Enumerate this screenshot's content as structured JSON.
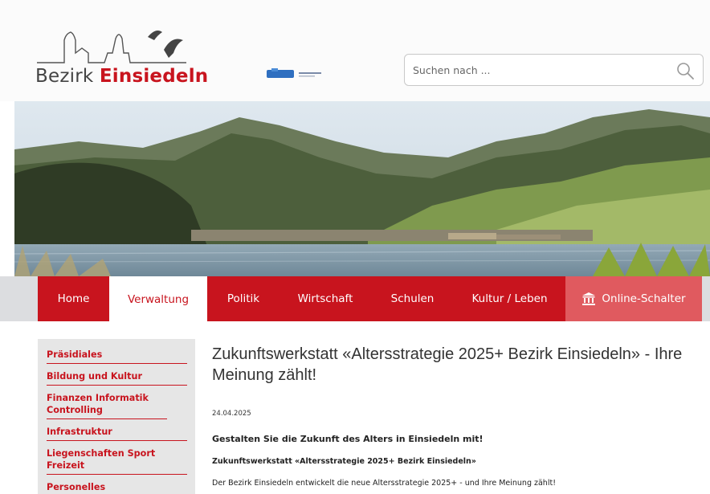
{
  "header": {
    "logo": {
      "text_light": "Bezirk",
      "text_bold": "Einsiedeln"
    },
    "search": {
      "placeholder": "Suchen nach ..."
    }
  },
  "nav": {
    "items": [
      {
        "label": "Home"
      },
      {
        "label": "Verwaltung",
        "active": true
      },
      {
        "label": "Politik"
      },
      {
        "label": "Wirtschaft"
      },
      {
        "label": "Schulen"
      },
      {
        "label": "Kultur / Leben"
      },
      {
        "label": "Online-Schalter",
        "icon": "bank-icon"
      }
    ]
  },
  "sidebar": {
    "items": [
      {
        "label": "Präsidiales"
      },
      {
        "label": "Bildung und Kultur"
      },
      {
        "label": "Finanzen Informatik Controlling"
      },
      {
        "label": "Infrastruktur"
      },
      {
        "label": "Liegenschaften Sport Freizeit"
      },
      {
        "label": "Personelles"
      }
    ]
  },
  "article": {
    "title": "Zukunftswerkstatt «Altersstrategie 2025+ Bezirk Einsiedeln» - Ihre Meinung zählt!",
    "date": "24.04.2025",
    "lead": "Gestalten Sie die Zukunft des Alters in Einsiedeln mit!",
    "subhead": "Zukunftswerkstatt «Altersstrategie 2025+ Bezirk Einsiedeln»",
    "body": "Der Bezirk Einsiedeln entwickelt die neue Altersstrategie 2025+ - und Ihre Meinung zählt!"
  },
  "colors": {
    "brand_red": "#c8141e",
    "online_red": "#e05a5f",
    "nav_bg": "#dcdde0",
    "sidebar_bg": "#e6e6e6"
  }
}
